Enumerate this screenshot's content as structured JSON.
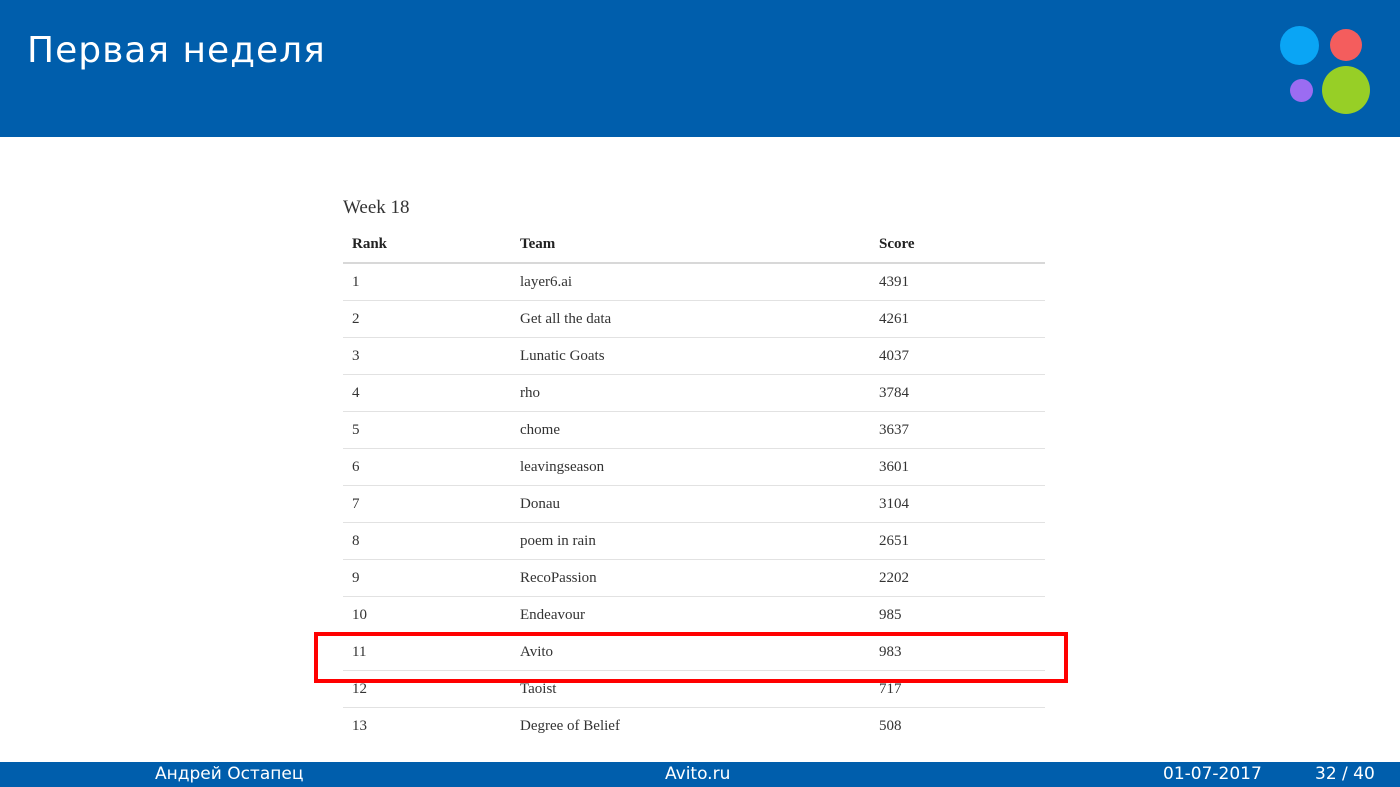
{
  "slide": {
    "title": "Первая неделя"
  },
  "logo": {
    "colors": [
      "#0aa5f5",
      "#f45d5d",
      "#9b6cf2",
      "#97cf26"
    ]
  },
  "leaderboard": {
    "title": "Week 18",
    "headers": [
      "Rank",
      "Team",
      "Score"
    ],
    "rows": [
      [
        "1",
        "layer6.ai",
        "4391"
      ],
      [
        "2",
        "Get all the data",
        "4261"
      ],
      [
        "3",
        "Lunatic Goats",
        "4037"
      ],
      [
        "4",
        "rho",
        "3784"
      ],
      [
        "5",
        "chome",
        "3637"
      ],
      [
        "6",
        "leavingseason",
        "3601"
      ],
      [
        "7",
        "Donau",
        "3104"
      ],
      [
        "8",
        "poem in rain",
        "2651"
      ],
      [
        "9",
        "RecoPassion",
        "2202"
      ],
      [
        "10",
        "Endeavour",
        "985"
      ],
      [
        "11",
        "Avito",
        "983"
      ],
      [
        "12",
        "Taoist",
        "717"
      ],
      [
        "13",
        "Degree of Belief",
        "508"
      ]
    ],
    "highlighted_rank": "11",
    "highlight_color": "#ff0000"
  },
  "footer": {
    "author": "Андрей Остапец",
    "organization": "Avito.ru",
    "date": "01-07-2017",
    "page": "32 / 40"
  },
  "theme": {
    "header_color": "#005eac"
  }
}
